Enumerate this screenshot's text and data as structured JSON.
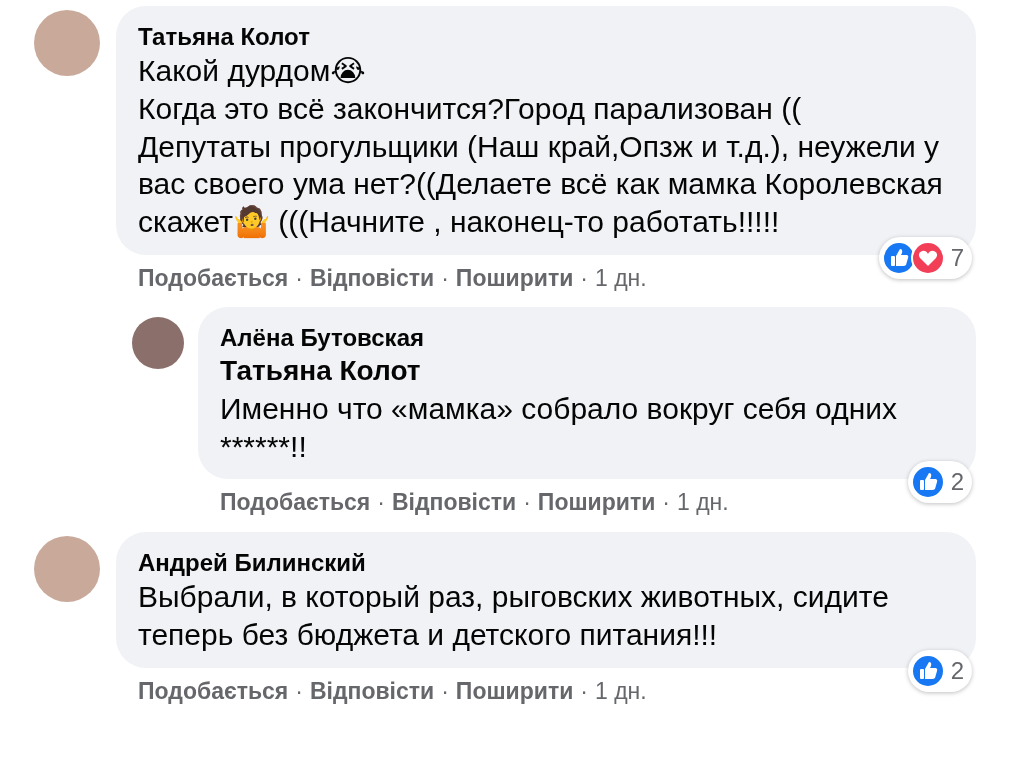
{
  "separator": "·",
  "comments": [
    {
      "author": "Татьяна Колот",
      "is_reply": false,
      "text": "Какой дурдом😭\nКогда это всё закончится?Город парализован ((\nДепутаты прогульщики (Наш край,Опзж и т.д.), неужели у вас своего ума нет?((Делаете всё как мамка Королевская скажет🤷 (((Начните , наконец-то работать!!!!!",
      "actions": [
        "Подобається",
        "Відповісти",
        "Поширити"
      ],
      "time": "1 дн.",
      "reactions": [
        {
          "kind": "like"
        },
        {
          "kind": "love"
        }
      ],
      "count": "7"
    },
    {
      "author": "Алёна Бутовская",
      "is_reply": true,
      "mention": "Татьяна Колот",
      "text": "Именно что «мамка» собрало вокруг себя одних ******!!",
      "actions": [
        "Подобається",
        "Відповісти",
        "Поширити"
      ],
      "time": "1 дн.",
      "reactions": [
        {
          "kind": "like"
        }
      ],
      "count": "2"
    },
    {
      "author": "Андрей Билинский",
      "is_reply": false,
      "text": "Выбрали, в который раз, рыговских животных, сидите теперь без бюджета и детского питания!!!",
      "actions": [
        "Подобається",
        "Відповісти",
        "Поширити"
      ],
      "time": "1 дн.",
      "reactions": [
        {
          "kind": "like"
        }
      ],
      "count": "2"
    }
  ]
}
